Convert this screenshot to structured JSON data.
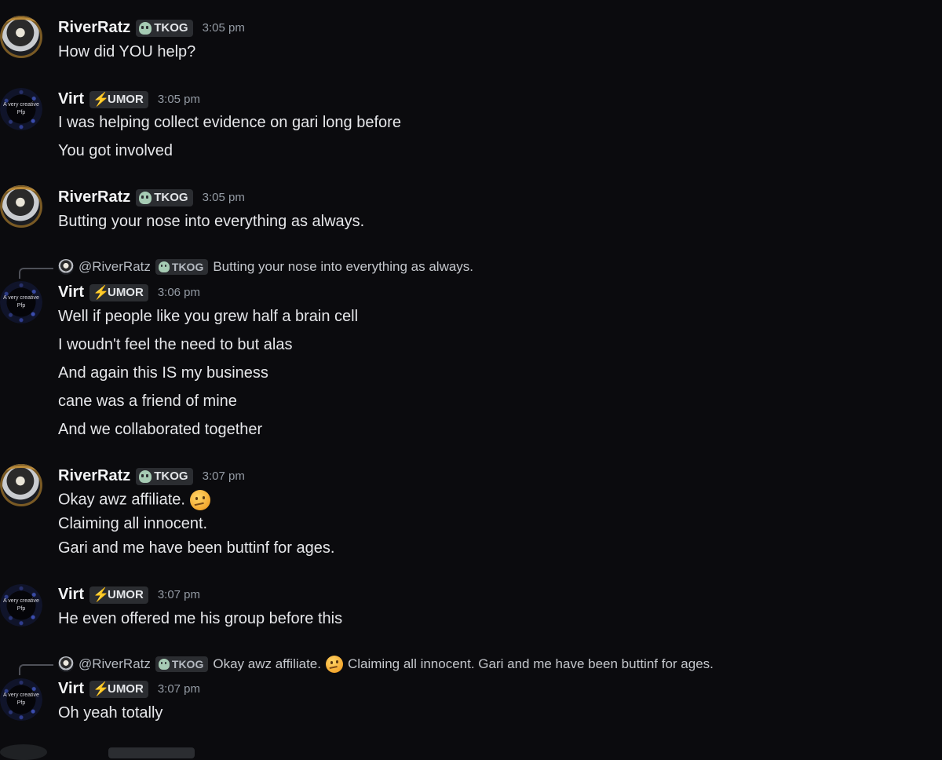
{
  "users": {
    "river": {
      "name": "RiverRatz",
      "tag": "TKOG",
      "tag_icon": "skull-icon"
    },
    "virt": {
      "name": "Virt",
      "tag": "UMOR",
      "tag_icon": "lightning-icon",
      "avatar_text_1": "A very creative",
      "avatar_text_2": "Pfp"
    }
  },
  "messages": [
    {
      "author": "RiverRatz",
      "time": "3:05 pm",
      "lines": [
        "How did YOU help?"
      ]
    },
    {
      "author": "Virt",
      "time": "3:05 pm",
      "lines": [
        "I was helping collect evidence on gari long before",
        "You got involved"
      ]
    },
    {
      "author": "RiverRatz",
      "time": "3:05 pm",
      "lines": [
        "Butting your nose into everything as always."
      ]
    },
    {
      "author": "Virt",
      "time": "3:06 pm",
      "reply": {
        "mention": "@RiverRatz",
        "tag": "TKOG",
        "text": "Butting your nose into everything as always."
      },
      "lines": [
        "Well if people like you grew half a brain cell",
        "I woudn't feel the need to but alas",
        "And again this IS my business",
        "cane was a friend of mine",
        "And we collaborated together"
      ]
    },
    {
      "author": "RiverRatz",
      "time": "3:07 pm",
      "lines": [
        "Okay awz affiliate.",
        "Claiming all innocent.",
        "Gari and me have been buttinf for ages."
      ],
      "emoji": "thinking-face-emoji"
    },
    {
      "author": "Virt",
      "time": "3:07 pm",
      "lines": [
        "He even offered me his group before this"
      ]
    },
    {
      "author": "Virt",
      "time": "3:07 pm",
      "reply": {
        "mention": "@RiverRatz",
        "tag": "TKOG",
        "text_a": "Okay awz affiliate.",
        "text_b": "Claiming all innocent. Gari and me have been buttinf for ages."
      },
      "lines": [
        "Oh yeah totally"
      ]
    }
  ]
}
